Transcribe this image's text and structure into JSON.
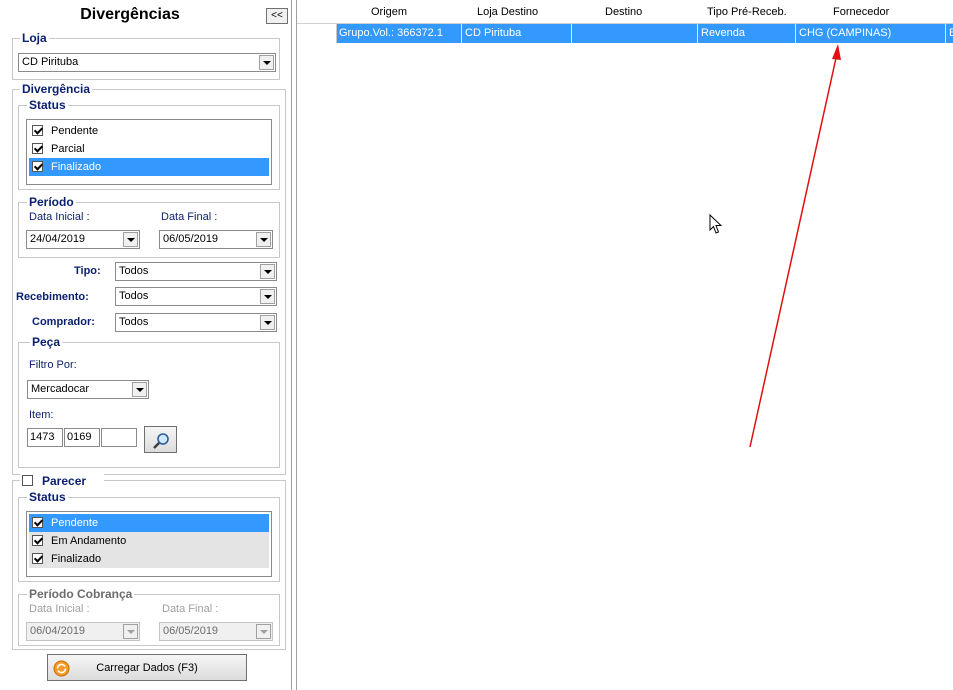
{
  "panel": {
    "title": "Divergências",
    "collapse_label": "<<",
    "loja": {
      "legend": "Loja",
      "value": "CD Pirituba"
    },
    "divergencia": {
      "legend": "Divergência",
      "status_legend": "Status",
      "status_items": [
        "Pendente",
        "Parcial",
        "Finalizado"
      ],
      "periodo": {
        "legend": "Período",
        "inicial_label": "Data Inicial :",
        "final_label": "Data Final :",
        "inicial_value": "24/04/2019",
        "final_value": "06/05/2019"
      },
      "tipo": {
        "label": "Tipo:",
        "value": "Todos"
      },
      "recebimento": {
        "label": "Recebimento:",
        "value": "Todos"
      },
      "comprador": {
        "label": "Comprador:",
        "value": "Todos"
      },
      "peca": {
        "legend": "Peça",
        "filtro_label": "Filtro Por:",
        "filtro_value": "Mercadocar",
        "item_label": "Item:",
        "item_1": "1473",
        "item_2": "0169",
        "item_3": ""
      }
    },
    "parecer": {
      "legend": "Parecer",
      "status_legend": "Status",
      "status_items": [
        "Pendente",
        "Em Andamento",
        "Finalizado"
      ],
      "periodo": {
        "legend": "Período Cobrança",
        "inicial_label": "Data Inicial :",
        "final_label": "Data Final :",
        "inicial_value": "06/04/2019",
        "final_value": "06/05/2019"
      }
    },
    "carregar_label": "Carregar Dados (F3)"
  },
  "grid": {
    "columns": [
      "Origem",
      "Loja Destino",
      "Destino",
      "Tipo Pré-Receb.",
      "Fornecedor"
    ],
    "rows": [
      {
        "origem": "Grupo.Vol.: 366372.1",
        "loja_destino": "CD Pirituba",
        "destino": "",
        "tipo": "Revenda",
        "fornecedor": "CHG (CAMPINAS)",
        "overflow": "B"
      }
    ]
  },
  "colors": {
    "selection": "#3399ff",
    "legend_text": "#0a1f6e",
    "annotation_arrow": "#e01010"
  }
}
